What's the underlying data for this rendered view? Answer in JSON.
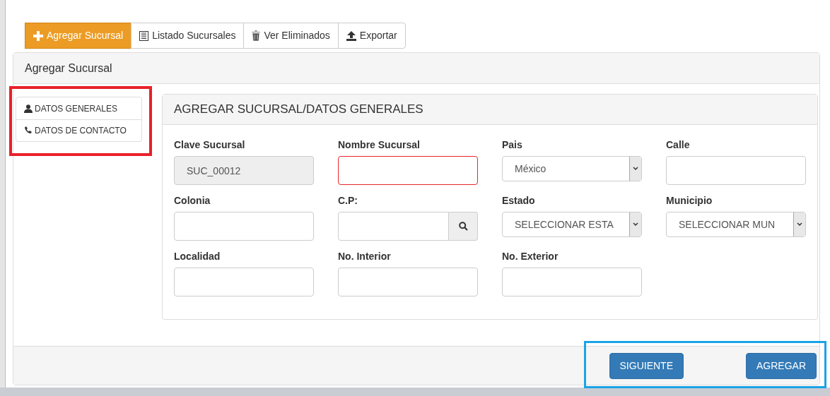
{
  "tabs": [
    {
      "label": "Agregar Sucursal",
      "selected": true
    },
    {
      "label": "Listado Sucursales",
      "selected": false
    },
    {
      "label": "Ver Eliminados",
      "selected": false
    },
    {
      "label": "Exportar",
      "selected": false
    }
  ],
  "panel": {
    "title": "Agregar Sucursal"
  },
  "side_nav": [
    {
      "label": "DATOS GENERALES"
    },
    {
      "label": "DATOS DE CONTACTO"
    }
  ],
  "form": {
    "title": "AGREGAR SUCURSAL/DATOS GENERALES",
    "fields": [
      {
        "label": "Clave Sucursal",
        "kind": "text",
        "value": "SUC_00012",
        "disabled": true,
        "invalid": false
      },
      {
        "label": "Nombre Sucursal",
        "kind": "text",
        "disabled": false,
        "invalid": true
      },
      {
        "label": "Pais",
        "kind": "select",
        "value": "México",
        "disabled": false,
        "invalid": false
      },
      {
        "label": "Calle",
        "kind": "text",
        "disabled": false,
        "invalid": false
      },
      {
        "label": "Colonia",
        "kind": "text",
        "disabled": false,
        "invalid": false
      },
      {
        "label": "C.P:",
        "kind": "search",
        "disabled": false,
        "invalid": false
      },
      {
        "label": "Estado",
        "kind": "select",
        "value": "SELECCIONAR ESTA",
        "disabled": false,
        "invalid": false
      },
      {
        "label": "Municipio",
        "kind": "select",
        "value": "SELECCIONAR MUN",
        "disabled": false,
        "invalid": false
      },
      {
        "label": "Localidad",
        "kind": "text",
        "disabled": false,
        "invalid": false
      },
      {
        "label": "No. Interior",
        "kind": "text",
        "disabled": false,
        "invalid": false
      },
      {
        "label": "No. Exterior",
        "kind": "text",
        "disabled": false,
        "invalid": false
      }
    ]
  },
  "footer_buttons": [
    "SIGUIENTE",
    "AGREGAR"
  ]
}
